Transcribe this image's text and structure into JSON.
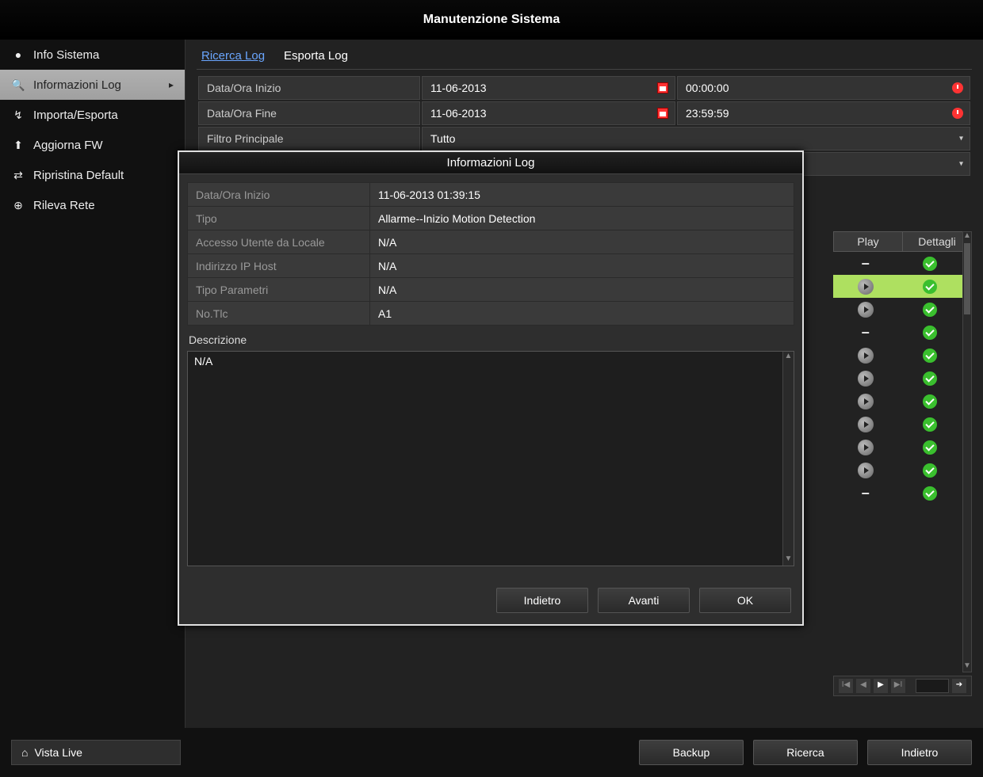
{
  "window_title": "Manutenzione Sistema",
  "sidebar": {
    "items": [
      {
        "icon": "●",
        "label": "Info Sistema"
      },
      {
        "icon": "🔍",
        "label": "Informazioni Log",
        "selected": true,
        "expandable": true
      },
      {
        "icon": "↯",
        "label": "Importa/Esporta"
      },
      {
        "icon": "⬆",
        "label": "Aggiorna FW"
      },
      {
        "icon": "⇄",
        "label": "Ripristina Default"
      },
      {
        "icon": "⊕",
        "label": "Rileva Rete"
      }
    ]
  },
  "tabs": {
    "search": "Ricerca Log",
    "export": "Esporta Log"
  },
  "filters": {
    "start_label": "Data/Ora Inizio",
    "start_date": "11-06-2013",
    "start_time": "00:00:00",
    "end_label": "Data/Ora Fine",
    "end_date": "11-06-2013",
    "end_time": "23:59:59",
    "primary_label": "Filtro Principale",
    "primary_value": "Tutto"
  },
  "results": {
    "play_hdr": "Play",
    "detail_hdr": "Dettagli",
    "rows": [
      {
        "play": "dash",
        "selected": false
      },
      {
        "play": "play",
        "selected": true
      },
      {
        "play": "play",
        "selected": false
      },
      {
        "play": "dash",
        "selected": false
      },
      {
        "play": "play",
        "selected": false
      },
      {
        "play": "play",
        "selected": false
      },
      {
        "play": "play",
        "selected": false
      },
      {
        "play": "play",
        "selected": false
      },
      {
        "play": "play",
        "selected": false
      },
      {
        "play": "play",
        "selected": false
      },
      {
        "play": "dash",
        "selected": false
      }
    ]
  },
  "footer": {
    "live_label": "Vista Live",
    "backup": "Backup",
    "search": "Ricerca",
    "back": "Indietro"
  },
  "modal": {
    "title": "Informazioni Log",
    "fields": {
      "start_label": "Data/Ora Inizio",
      "start_value": "11-06-2013 01:39:15",
      "type_label": "Tipo",
      "type_value": "Allarme--Inizio Motion Detection",
      "localuser_label": "Accesso Utente da Locale",
      "localuser_value": "N/A",
      "hostip_label": "Indirizzo IP Host",
      "hostip_value": "N/A",
      "paramtype_label": "Tipo Parametri",
      "paramtype_value": "N/A",
      "notlc_label": "No.Tlc",
      "notlc_value": "A1"
    },
    "description_label": "Descrizione",
    "description_value": "N/A",
    "buttons": {
      "prev": "Indietro",
      "next": "Avanti",
      "ok": "OK"
    }
  }
}
